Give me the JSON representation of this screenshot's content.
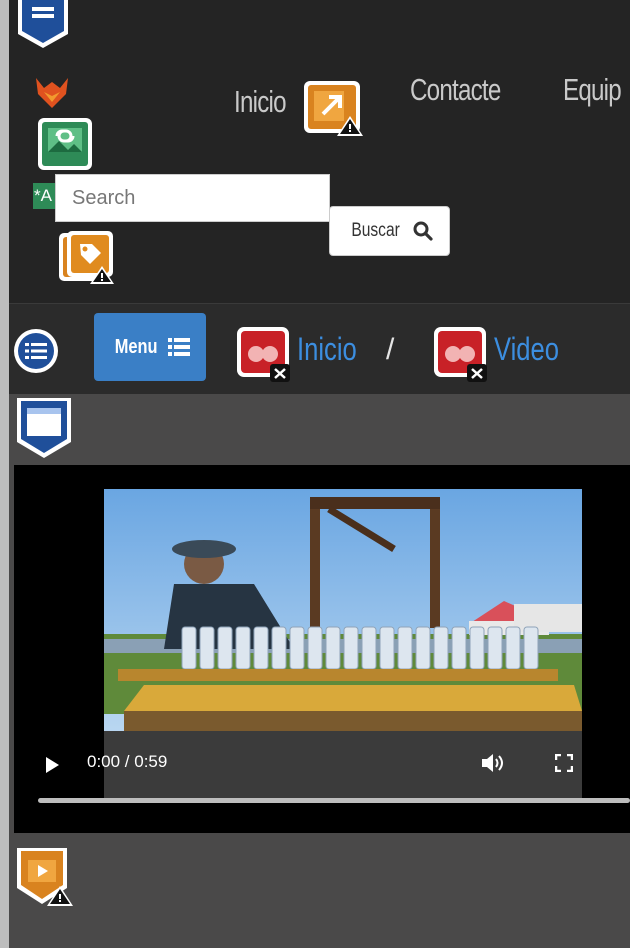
{
  "nav": {
    "inicio": "Inicio",
    "contacte": "Contacte",
    "equipo": "Equip"
  },
  "search": {
    "placeholder": "Search",
    "button_label": "Buscar"
  },
  "alt_text_badge": "*A",
  "menu": {
    "label": "Menu"
  },
  "breadcrumb": {
    "items": [
      "Inicio",
      "Video"
    ],
    "separator": "/"
  },
  "video": {
    "time": "0:00 / 0:59",
    "progress": 0
  },
  "colors": {
    "header_bg": "#242424",
    "accent_blue": "#3a7fc6",
    "link_blue": "#3c8ee0"
  }
}
